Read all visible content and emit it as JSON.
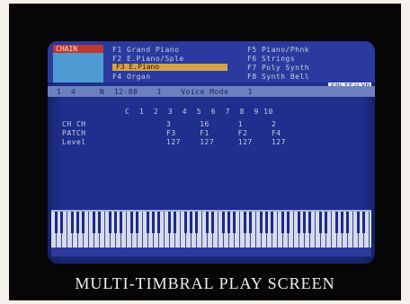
{
  "screen": {
    "mode_label": "CHAIN",
    "patch_list": [
      {
        "col1": "F1 Grand Piano",
        "col2": "F5 Piano/Phnk"
      },
      {
        "col1": "F2 E.Piano/Sple",
        "col2": "F6 Strings"
      },
      {
        "col1": "F3 E.Piano",
        "col2": "F7 Poly Synth"
      },
      {
        "col1": "F4 Organ",
        "col2": "F8 Synth Bell"
      }
    ],
    "selected_patch": "F3 E.Piano",
    "badge": "SPLIT/LYR",
    "info_strip": "1  4     N  12-08    1    Voice Mode    1",
    "channel_header": "C  1  2  3  4  5  6  7  8  9 10",
    "rows": [
      {
        "label": "CH CH",
        "values": "3      16      1      2"
      },
      {
        "label": "PATCH",
        "values": "F3     F1      F2     F4"
      },
      {
        "label": "Level",
        "values": "127    127     127    127"
      }
    ]
  },
  "caption": "MULTI-TIMBRAL PLAY SCREEN",
  "colors": {
    "screen_bg": "#1f2f8e",
    "mode_tab": "#c0382e",
    "highlight": "#d4a24b",
    "keyboard": "#d7dbe8"
  }
}
